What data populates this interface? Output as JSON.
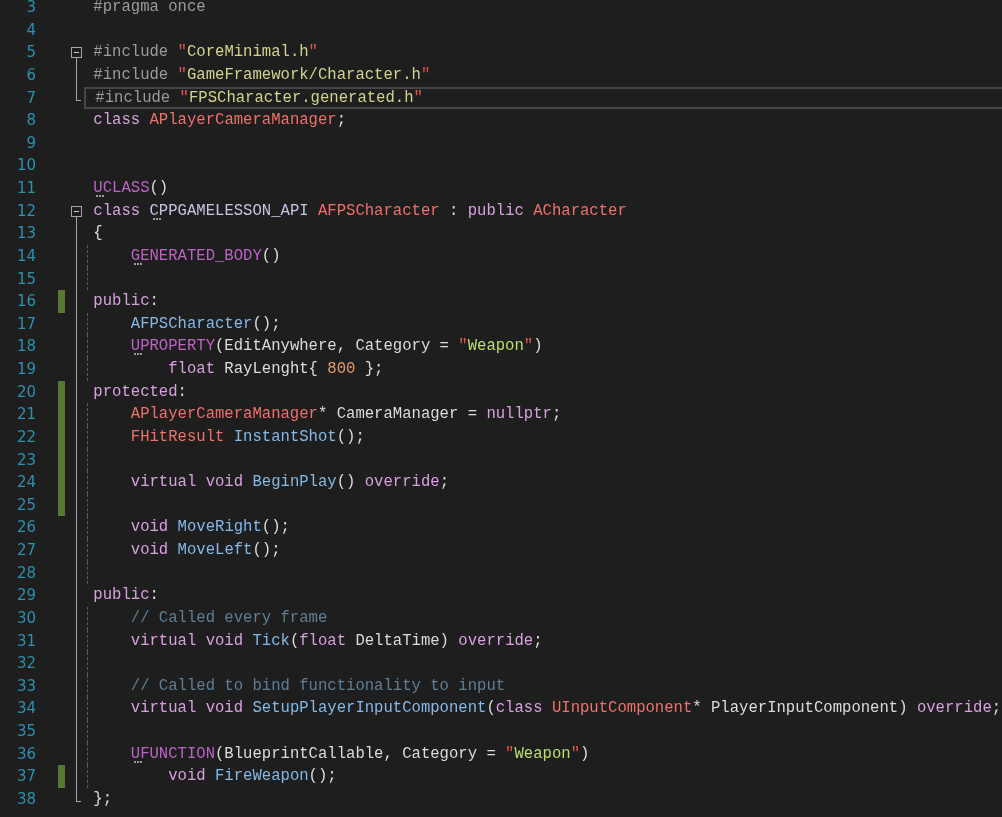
{
  "editor": {
    "lines": [
      {
        "number": "3",
        "kind": "plain",
        "changed": false,
        "current": false,
        "indent_guide": false,
        "tokens": [
          {
            "text": "#pragma once",
            "kind": "preproc",
            "hint": false
          }
        ]
      },
      {
        "number": "4",
        "kind": "plain",
        "changed": false,
        "current": false,
        "indent_guide": false
      },
      {
        "number": "5",
        "kind": "fold_start",
        "changed": false,
        "current": false,
        "indent_guide": false,
        "tokens": [
          {
            "text": "#include ",
            "kind": "preproc",
            "hint": false
          },
          {
            "text": "\"",
            "kind": "quote",
            "hint": false
          },
          {
            "text": "CoreMinimal.h",
            "kind": "include_path",
            "hint": false
          },
          {
            "text": "\"",
            "kind": "quote",
            "hint": false
          }
        ]
      },
      {
        "number": "6",
        "kind": "fold_body",
        "changed": false,
        "current": false,
        "indent_guide": false,
        "tokens": [
          {
            "text": "#include ",
            "kind": "preproc",
            "hint": false
          },
          {
            "text": "\"",
            "kind": "quote",
            "hint": false
          },
          {
            "text": "GameFramework/Character.h",
            "kind": "include_path",
            "hint": false
          },
          {
            "text": "\"",
            "kind": "quote",
            "hint": false
          }
        ]
      },
      {
        "number": "7",
        "kind": "fold_end",
        "changed": false,
        "current": true,
        "indent_guide": false,
        "tokens": [
          {
            "text": "#include ",
            "kind": "preproc",
            "hint": false
          },
          {
            "text": "\"",
            "kind": "quote",
            "hint": false
          },
          {
            "text": "FPSCharacter.generated.h",
            "kind": "include_path",
            "hint": false
          },
          {
            "text": "\"",
            "kind": "quote",
            "hint": false
          }
        ]
      },
      {
        "number": "8",
        "kind": "plain",
        "changed": false,
        "current": false,
        "indent_guide": false,
        "tokens": [
          {
            "text": "class ",
            "kind": "keyword",
            "hint": false
          },
          {
            "text": "APlayerCameraManager",
            "kind": "type",
            "hint": false
          },
          {
            "text": ";",
            "kind": "plain",
            "hint": false
          }
        ]
      },
      {
        "number": "9",
        "kind": "plain",
        "changed": false,
        "current": false,
        "indent_guide": false
      },
      {
        "number": "10",
        "kind": "plain",
        "changed": false,
        "current": false,
        "indent_guide": false
      },
      {
        "number": "11",
        "kind": "plain",
        "changed": false,
        "current": false,
        "indent_guide": false,
        "tokens": [
          {
            "text": "UCLASS",
            "kind": "macro",
            "hint": true
          },
          {
            "text": "()",
            "kind": "plain",
            "hint": false
          }
        ]
      },
      {
        "number": "12",
        "kind": "fold_start",
        "changed": false,
        "current": false,
        "indent_guide": false,
        "tokens": [
          {
            "text": "class ",
            "kind": "keyword",
            "hint": false
          },
          {
            "text": "CPPGAMELESSON_API ",
            "kind": "api_macro",
            "hint": true
          },
          {
            "text": "AFPSCharacter",
            "kind": "type",
            "hint": false
          },
          {
            "text": " : ",
            "kind": "plain",
            "hint": false
          },
          {
            "text": "public ",
            "kind": "keyword",
            "hint": false
          },
          {
            "text": "ACharacter",
            "kind": "type",
            "hint": false
          }
        ]
      },
      {
        "number": "13",
        "kind": "fold_body",
        "changed": false,
        "current": false,
        "indent_guide": false,
        "tokens": [
          {
            "text": "{",
            "kind": "plain",
            "hint": false
          }
        ]
      },
      {
        "number": "14",
        "kind": "fold_body",
        "changed": false,
        "current": false,
        "indent_guide": true,
        "tokens": [
          {
            "text": "    GENERATED_BODY",
            "kind": "macro",
            "hint": true
          },
          {
            "text": "()",
            "kind": "plain",
            "hint": false
          }
        ]
      },
      {
        "number": "15",
        "kind": "fold_body",
        "changed": false,
        "current": false,
        "indent_guide": true
      },
      {
        "number": "16",
        "kind": "fold_body",
        "changed": true,
        "current": false,
        "indent_guide": false,
        "tokens": [
          {
            "text": "public",
            "kind": "keyword",
            "hint": false
          },
          {
            "text": ":",
            "kind": "plain",
            "hint": false
          }
        ]
      },
      {
        "number": "17",
        "kind": "fold_body",
        "changed": false,
        "current": false,
        "indent_guide": true,
        "tokens": [
          {
            "text": "    AFPSCharacter",
            "kind": "function",
            "hint": false
          },
          {
            "text": "();",
            "kind": "plain",
            "hint": false
          }
        ]
      },
      {
        "number": "18",
        "kind": "fold_body",
        "changed": false,
        "current": false,
        "indent_guide": true,
        "tokens": [
          {
            "text": "    UPROPERTY",
            "kind": "macro",
            "hint": true
          },
          {
            "text": "(EditAnywhere, Category = ",
            "kind": "plain",
            "hint": false
          },
          {
            "text": "\"",
            "kind": "quote",
            "hint": false
          },
          {
            "text": "Weapon",
            "kind": "string",
            "hint": false
          },
          {
            "text": "\"",
            "kind": "quote",
            "hint": false
          },
          {
            "text": ")",
            "kind": "plain",
            "hint": false
          }
        ]
      },
      {
        "number": "19",
        "kind": "fold_body",
        "changed": false,
        "current": false,
        "indent_guide": true,
        "tokens": [
          {
            "text": "        float",
            "kind": "keyword",
            "hint": false
          },
          {
            "text": " RayLenght{ ",
            "kind": "plain",
            "hint": false
          },
          {
            "text": "800",
            "kind": "number",
            "hint": false
          },
          {
            "text": " };",
            "kind": "plain",
            "hint": false
          }
        ]
      },
      {
        "number": "20",
        "kind": "fold_body",
        "changed": true,
        "current": false,
        "indent_guide": false,
        "tokens": [
          {
            "text": "protected",
            "kind": "keyword",
            "hint": false
          },
          {
            "text": ":",
            "kind": "plain",
            "hint": false
          }
        ]
      },
      {
        "number": "21",
        "kind": "fold_body",
        "changed": true,
        "current": false,
        "indent_guide": true,
        "tokens": [
          {
            "text": "    APlayerCameraManager",
            "kind": "type",
            "hint": false
          },
          {
            "text": "* CameraManager = ",
            "kind": "plain",
            "hint": false
          },
          {
            "text": "nullptr",
            "kind": "keyword",
            "hint": false
          },
          {
            "text": ";",
            "kind": "plain",
            "hint": false
          }
        ]
      },
      {
        "number": "22",
        "kind": "fold_body",
        "changed": true,
        "current": false,
        "indent_guide": true,
        "tokens": [
          {
            "text": "    FHitResult ",
            "kind": "type",
            "hint": false
          },
          {
            "text": "InstantShot",
            "kind": "function",
            "hint": false
          },
          {
            "text": "();",
            "kind": "plain",
            "hint": false
          }
        ]
      },
      {
        "number": "23",
        "kind": "fold_body",
        "changed": true,
        "current": false,
        "indent_guide": true
      },
      {
        "number": "24",
        "kind": "fold_body",
        "changed": true,
        "current": false,
        "indent_guide": true,
        "tokens": [
          {
            "text": "    virtual void ",
            "kind": "keyword",
            "hint": false
          },
          {
            "text": "BeginPlay",
            "kind": "function",
            "hint": false
          },
          {
            "text": "() ",
            "kind": "plain",
            "hint": false
          },
          {
            "text": "override",
            "kind": "keyword",
            "hint": false
          },
          {
            "text": ";",
            "kind": "plain",
            "hint": false
          }
        ]
      },
      {
        "number": "25",
        "kind": "fold_body",
        "changed": true,
        "current": false,
        "indent_guide": true
      },
      {
        "number": "26",
        "kind": "fold_body",
        "changed": false,
        "current": false,
        "indent_guide": true,
        "tokens": [
          {
            "text": "    void ",
            "kind": "keyword",
            "hint": false
          },
          {
            "text": "MoveRight",
            "kind": "function",
            "hint": false
          },
          {
            "text": "();",
            "kind": "plain",
            "hint": false
          }
        ]
      },
      {
        "number": "27",
        "kind": "fold_body",
        "changed": false,
        "current": false,
        "indent_guide": true,
        "tokens": [
          {
            "text": "    void ",
            "kind": "keyword",
            "hint": false
          },
          {
            "text": "MoveLeft",
            "kind": "function",
            "hint": false
          },
          {
            "text": "();",
            "kind": "plain",
            "hint": false
          }
        ]
      },
      {
        "number": "28",
        "kind": "fold_body",
        "changed": false,
        "current": false,
        "indent_guide": true
      },
      {
        "number": "29",
        "kind": "fold_body",
        "changed": false,
        "current": false,
        "indent_guide": false,
        "tokens": [
          {
            "text": "public",
            "kind": "keyword",
            "hint": false
          },
          {
            "text": ":",
            "kind": "plain",
            "hint": false
          }
        ]
      },
      {
        "number": "30",
        "kind": "fold_body",
        "changed": false,
        "current": false,
        "indent_guide": true,
        "tokens": [
          {
            "text": "    // Called every frame",
            "kind": "comment",
            "hint": false
          }
        ]
      },
      {
        "number": "31",
        "kind": "fold_body",
        "changed": false,
        "current": false,
        "indent_guide": true,
        "tokens": [
          {
            "text": "    virtual void ",
            "kind": "keyword",
            "hint": false
          },
          {
            "text": "Tick",
            "kind": "function",
            "hint": false
          },
          {
            "text": "(",
            "kind": "plain",
            "hint": false
          },
          {
            "text": "float",
            "kind": "keyword",
            "hint": false
          },
          {
            "text": " DeltaTime) ",
            "kind": "plain",
            "hint": false
          },
          {
            "text": "override",
            "kind": "keyword",
            "hint": false
          },
          {
            "text": ";",
            "kind": "plain",
            "hint": false
          }
        ]
      },
      {
        "number": "32",
        "kind": "fold_body",
        "changed": false,
        "current": false,
        "indent_guide": true
      },
      {
        "number": "33",
        "kind": "fold_body",
        "changed": false,
        "current": false,
        "indent_guide": true,
        "tokens": [
          {
            "text": "    // Called to bind functionality to input",
            "kind": "comment",
            "hint": false
          }
        ]
      },
      {
        "number": "34",
        "kind": "fold_body",
        "changed": false,
        "current": false,
        "indent_guide": true,
        "tokens": [
          {
            "text": "    virtual void ",
            "kind": "keyword",
            "hint": false
          },
          {
            "text": "SetupPlayerInputComponent",
            "kind": "function",
            "hint": false
          },
          {
            "text": "(",
            "kind": "plain",
            "hint": false
          },
          {
            "text": "class ",
            "kind": "keyword",
            "hint": false
          },
          {
            "text": "UInputComponent",
            "kind": "type",
            "hint": false
          },
          {
            "text": "* PlayerInputComponent) ",
            "kind": "plain",
            "hint": false
          },
          {
            "text": "override",
            "kind": "keyword",
            "hint": false
          },
          {
            "text": ";",
            "kind": "plain",
            "hint": false
          }
        ]
      },
      {
        "number": "35",
        "kind": "fold_body",
        "changed": false,
        "current": false,
        "indent_guide": true
      },
      {
        "number": "36",
        "kind": "fold_body",
        "changed": false,
        "current": false,
        "indent_guide": true,
        "tokens": [
          {
            "text": "    UFUNCTION",
            "kind": "macro",
            "hint": true
          },
          {
            "text": "(BlueprintCallable, Category = ",
            "kind": "plain",
            "hint": false
          },
          {
            "text": "\"",
            "kind": "quote",
            "hint": false
          },
          {
            "text": "Weapon",
            "kind": "string",
            "hint": false
          },
          {
            "text": "\"",
            "kind": "quote",
            "hint": false
          },
          {
            "text": ")",
            "kind": "plain",
            "hint": false
          }
        ]
      },
      {
        "number": "37",
        "kind": "fold_body",
        "changed": true,
        "current": false,
        "indent_guide": true,
        "tokens": [
          {
            "text": "        void ",
            "kind": "keyword",
            "hint": false
          },
          {
            "text": "FireWeapon",
            "kind": "function",
            "hint": false
          },
          {
            "text": "();",
            "kind": "plain",
            "hint": false
          }
        ]
      },
      {
        "number": "38",
        "kind": "fold_end",
        "changed": false,
        "current": false,
        "indent_guide": false,
        "tokens": [
          {
            "text": "};",
            "kind": "plain",
            "hint": false
          }
        ]
      }
    ]
  }
}
